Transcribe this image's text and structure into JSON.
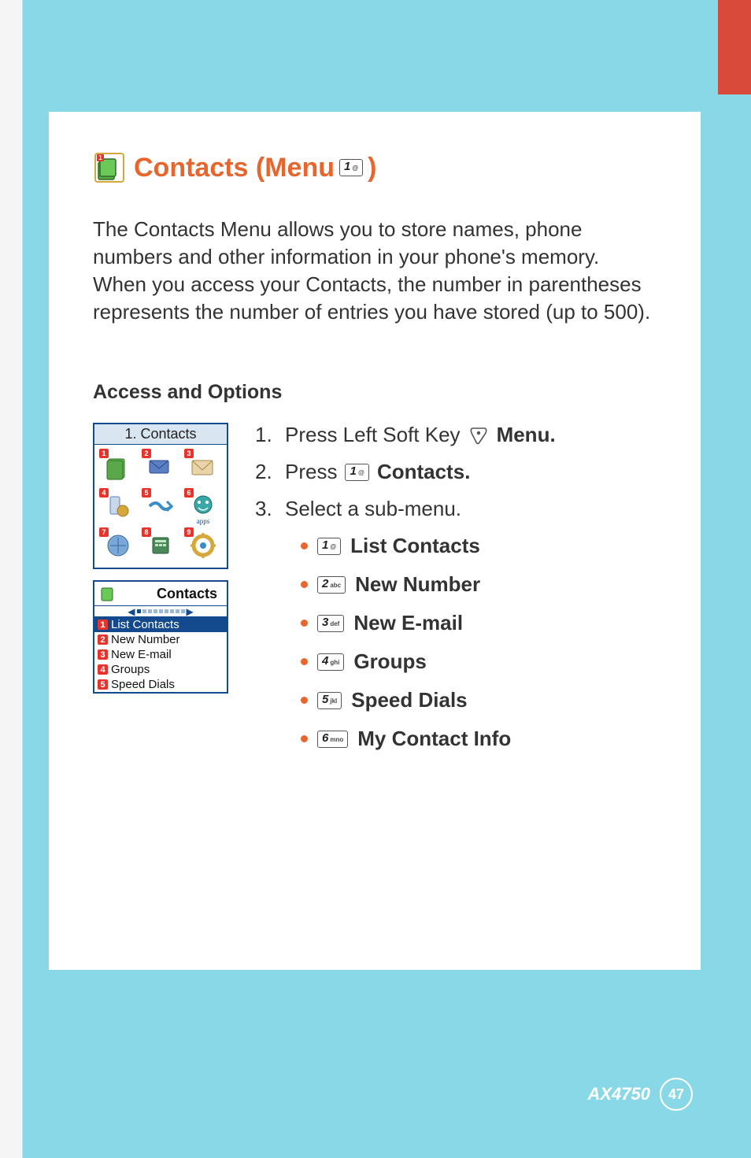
{
  "title": {
    "prefix": "Contacts (Menu",
    "key": {
      "big": "1",
      "small": "@"
    },
    "suffix": ")"
  },
  "intro": "The Contacts Menu allows you to store names, phone numbers and other information in your phone's memory. When you access your Contacts, the number in parentheses represents the number of entries you have stored (up to 500).",
  "subhead": "Access and Options",
  "screen1": {
    "title": "1. Contacts",
    "icons": [
      "1",
      "2",
      "3",
      "4",
      "5",
      "6",
      "7",
      "8",
      "9"
    ],
    "apps_label": "apps"
  },
  "screen2": {
    "title": "Contacts",
    "items": [
      {
        "n": "1",
        "label": "List Contacts"
      },
      {
        "n": "2",
        "label": "New Number"
      },
      {
        "n": "3",
        "label": "New E-mail"
      },
      {
        "n": "4",
        "label": "Groups"
      },
      {
        "n": "5",
        "label": "Speed Dials"
      }
    ]
  },
  "steps": {
    "s1_pre": "Press Left Soft Key",
    "s1_bold": "Menu",
    "s2_pre": "Press",
    "s2_key": {
      "big": "1",
      "small": "@"
    },
    "s2_bold": "Contacts",
    "s3": "Select a sub-menu."
  },
  "submenu": [
    {
      "key": {
        "big": "1",
        "small": "@"
      },
      "label": "List Contacts"
    },
    {
      "key": {
        "big": "2",
        "small": "abc"
      },
      "label": "New Number"
    },
    {
      "key": {
        "big": "3",
        "small": "def"
      },
      "label": "New E-mail"
    },
    {
      "key": {
        "big": "4",
        "small": "ghi"
      },
      "label": "Groups"
    },
    {
      "key": {
        "big": "5",
        "small": "jkl"
      },
      "label": "Speed Dials"
    },
    {
      "key": {
        "big": "6",
        "small": "mno"
      },
      "label": "My Contact Info"
    }
  ],
  "footer": {
    "model": "AX4750",
    "page": "47"
  }
}
